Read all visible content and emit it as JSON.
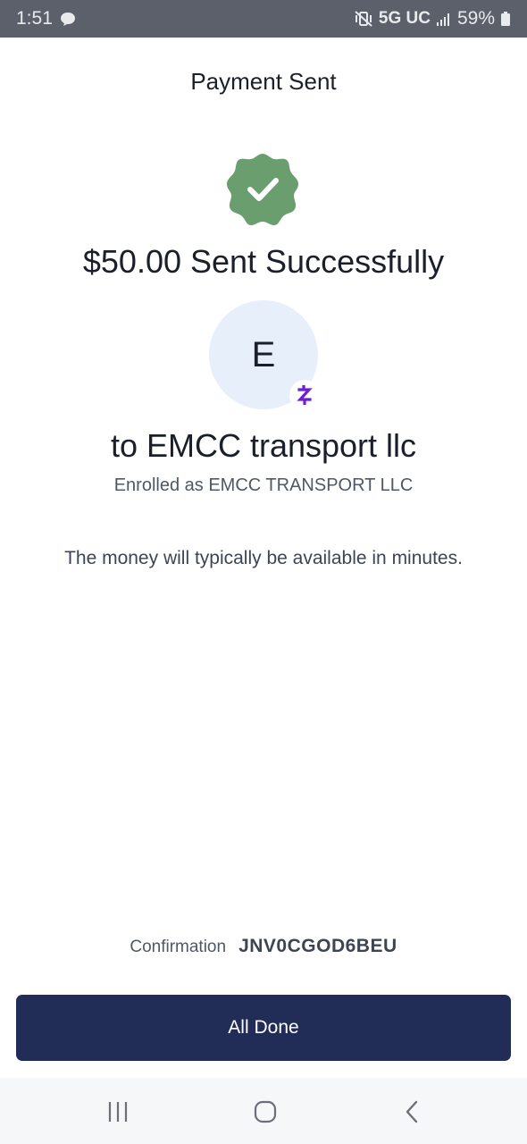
{
  "status_bar": {
    "time": "1:51",
    "network": "5G UC",
    "battery": "59%",
    "icons": [
      "chat-bubble-icon",
      "vibrate-mute-icon",
      "signal-icon",
      "battery-icon"
    ]
  },
  "header": {
    "title": "Payment Sent"
  },
  "success": {
    "icon": "check-badge-icon",
    "color": "#6a9e6e",
    "message": "$50.00 Sent Successfully"
  },
  "recipient": {
    "avatar_initial": "E",
    "avatar_bg": "#e7effa",
    "badge_icon": "zelle-icon",
    "badge_color": "#6d1ed4",
    "name_line": "to EMCC transport llc",
    "enrolled_line": "Enrolled as EMCC TRANSPORT LLC"
  },
  "info": {
    "availability": "The money will typically be available in minutes."
  },
  "confirmation": {
    "label": "Confirmation",
    "code": "JNV0CGOD6BEU"
  },
  "actions": {
    "done_label": "All Done",
    "done_color": "#212d57"
  },
  "nav_bar": {
    "icons": [
      "recent-apps-icon",
      "home-icon",
      "back-icon"
    ]
  }
}
